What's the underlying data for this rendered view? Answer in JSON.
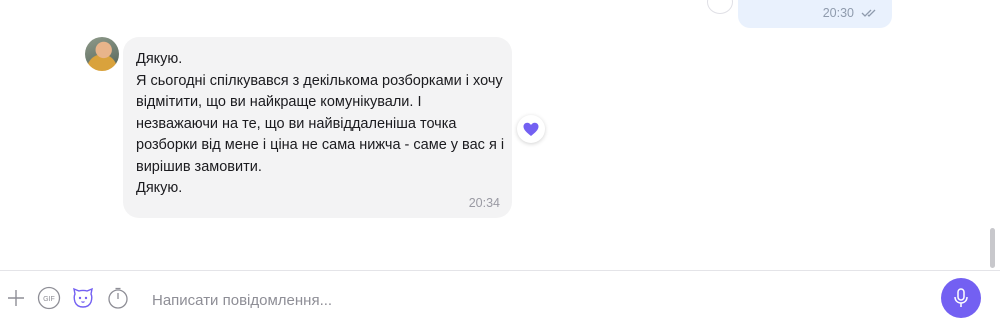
{
  "outgoing_message": {
    "time": "20:30",
    "status": "double-check-icon"
  },
  "incoming_message": {
    "text": "Дякую.\nЯ сьогодні спілкувався з декількома розборками і хочу відмітити, що ви найкраще комунікували. І незважаючи на те, що ви найвіддаленіша точка розборки від мене і ціна не сама нижча - саме у вас я і вирішив замовити.\nДякую.",
    "time": "20:34",
    "reaction_icon": "heart-icon"
  },
  "composer": {
    "placeholder": "Написати повідомлення...",
    "value": "",
    "tools": [
      "plus-icon",
      "gif-icon",
      "sticker-icon",
      "timer-icon"
    ],
    "send_icon": "microphone-icon"
  },
  "colors": {
    "accent": "#7360f2",
    "incoming_bubble": "#f3f3f4",
    "outgoing_bubble": "#e9f1fd"
  }
}
